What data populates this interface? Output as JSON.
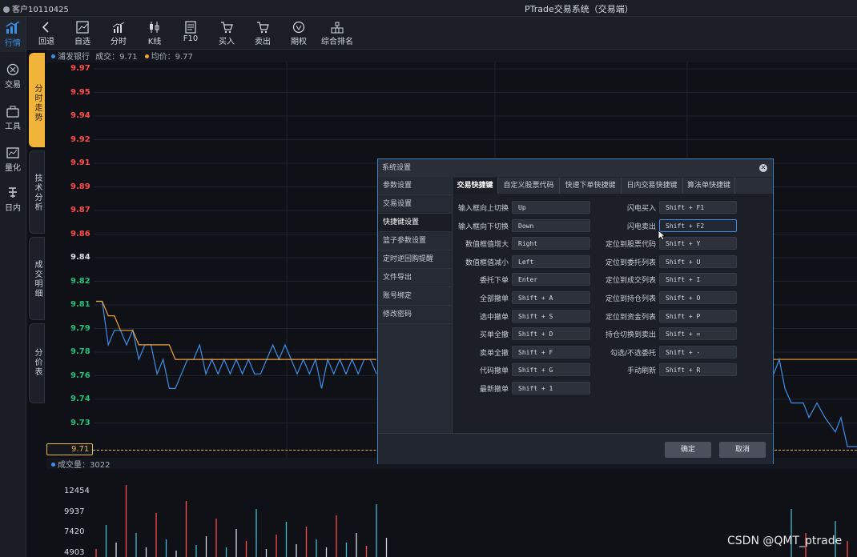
{
  "titlebar": {
    "account": "客户10110425",
    "system_title": "PTrade交易系统（交易端）"
  },
  "left_nav": [
    {
      "label": "行情",
      "icon": "market-icon",
      "active": true
    },
    {
      "label": "交易",
      "icon": "trade-icon"
    },
    {
      "label": "工具",
      "icon": "toolbox-icon"
    },
    {
      "label": "量化",
      "icon": "quant-icon"
    },
    {
      "label": "日内",
      "icon": "intraday-icon"
    }
  ],
  "toolbar": [
    {
      "label": "回退",
      "icon": "back-icon"
    },
    {
      "label": "自选",
      "icon": "watchlist-icon"
    },
    {
      "label": "分时",
      "icon": "timeshare-icon"
    },
    {
      "label": "K线",
      "icon": "kline-icon"
    },
    {
      "label": "F10",
      "icon": "document-icon"
    },
    {
      "label": "买入",
      "icon": "cart-buy-icon"
    },
    {
      "label": "卖出",
      "icon": "cart-sell-icon"
    },
    {
      "label": "期权",
      "icon": "option-icon"
    },
    {
      "label": "综合排名",
      "icon": "ranking-icon"
    }
  ],
  "vertical_tabs": [
    "分时走势",
    "技术分析",
    "成交明细",
    "分价表"
  ],
  "chart_legend": {
    "stock": "浦发银行",
    "deal": "成交：9.71",
    "avg": "均价：9.77"
  },
  "price_labels": [
    "9.97",
    "9.95",
    "9.94",
    "9.92",
    "9.91",
    "9.89",
    "9.87",
    "9.86",
    "9.84",
    "9.82",
    "9.81",
    "9.79",
    "9.78",
    "9.76",
    "9.74",
    "9.73",
    "9.71"
  ],
  "current_price": "9.71",
  "volume_legend": "成交量：3022",
  "volume_labels": [
    "12454",
    "9937",
    "7420",
    "4903"
  ],
  "colors": {
    "up": "#ff4d4d",
    "down": "#22c07a",
    "neutral": "#d7dbe3",
    "price_line": "#3d8fe8",
    "avg_line": "#f0a23a",
    "accent": "#3d8fe8"
  },
  "chart_data": {
    "type": "line",
    "series": [
      {
        "values": [
          9.81,
          9.81,
          9.78,
          9.79,
          9.79,
          9.78,
          9.79,
          9.77,
          9.78,
          9.78,
          9.76,
          9.77,
          9.75,
          9.75,
          9.76,
          9.77,
          9.77,
          9.78,
          9.76,
          9.77,
          9.76,
          9.77,
          9.76,
          9.77,
          9.76,
          9.77,
          9.76,
          9.76,
          9.77,
          9.78,
          9.77,
          9.78,
          9.77,
          9.76,
          9.77,
          9.76,
          9.77,
          9.75,
          9.77,
          9.76,
          9.77,
          9.76,
          9.77,
          9.76,
          9.77,
          9.77,
          9.76
        ]
      },
      {
        "values": [
          9.81,
          9.81,
          9.8,
          9.8,
          9.79,
          9.79,
          9.79,
          9.78,
          9.78,
          9.78,
          9.78,
          9.78,
          9.78,
          9.77,
          9.77,
          9.77,
          9.77,
          9.77,
          9.77,
          9.77,
          9.77,
          9.77,
          9.77,
          9.77,
          9.77,
          9.77,
          9.77,
          9.77,
          9.77,
          9.77,
          9.77,
          9.77,
          9.77,
          9.77,
          9.77,
          9.77,
          9.77,
          9.77,
          9.77,
          9.77,
          9.77,
          9.77,
          9.77,
          9.77,
          9.77,
          9.77,
          9.77
        ]
      }
    ],
    "ylim": [
      9.71,
      9.97
    ]
  },
  "dialog": {
    "title": "系统设置",
    "side_items": [
      "参数设置",
      "交易设置",
      "快捷键设置",
      "篮子参数设置",
      "定时逆回购提醒",
      "文件导出",
      "账号绑定",
      "修改密码"
    ],
    "active_side": 2,
    "tabs": [
      "交易快捷键",
      "自定义股票代码",
      "快速下单快捷键",
      "日内交易快捷键",
      "算法单快捷键"
    ],
    "left_rows": [
      {
        "label": "输入框向上切换",
        "key": "Up"
      },
      {
        "label": "输入框向下切换",
        "key": "Down"
      },
      {
        "label": "数值框值增大",
        "key": "Right"
      },
      {
        "label": "数值框值减小",
        "key": "Left"
      },
      {
        "label": "委托下单",
        "key": "Enter"
      },
      {
        "label": "全部撤单",
        "key": "Shift + A"
      },
      {
        "label": "选中撤单",
        "key": "Shift + S"
      },
      {
        "label": "买单全撤",
        "key": "Shift + D"
      },
      {
        "label": "卖单全撤",
        "key": "Shift + F"
      },
      {
        "label": "代码撤单",
        "key": "Shift + G"
      },
      {
        "label": "最新撤单",
        "key": "Shift + 1"
      }
    ],
    "right_rows": [
      {
        "label": "闪电买入",
        "key": "Shift + F1"
      },
      {
        "label": "闪电卖出",
        "key": "Shift + F2"
      },
      {
        "label": "定位到股票代码",
        "key": "Shift + Y"
      },
      {
        "label": "定位到委托列表",
        "key": "Shift + U"
      },
      {
        "label": "定位到成交列表",
        "key": "Shift + I"
      },
      {
        "label": "定位到持仓列表",
        "key": "Shift + O"
      },
      {
        "label": "定位到资金列表",
        "key": "Shift + P"
      },
      {
        "label": "持仓切换到卖出",
        "key": "Shift + ="
      },
      {
        "label": "勾选/不选委托",
        "key": "Shift + -"
      },
      {
        "label": "手动刷新",
        "key": "Shift + R"
      }
    ],
    "ok_label": "确定",
    "cancel_label": "取消"
  },
  "watermark": "CSDN @QMT_ptrade"
}
